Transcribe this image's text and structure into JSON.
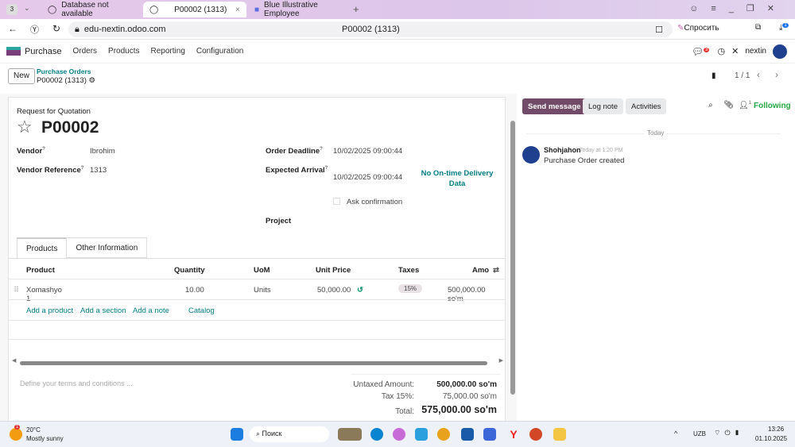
{
  "browser": {
    "tab_count": "3",
    "tabs": [
      {
        "label": "Database not available"
      },
      {
        "label": "P00002 (1313)"
      },
      {
        "label": "Blue Illustrative Employee"
      }
    ],
    "url": "edu-nextin.odoo.com",
    "page_title": "P00002 (1313)",
    "ask_label": "Спросить",
    "download_badge": "1"
  },
  "navbar": {
    "app": "Purchase",
    "menus": [
      "Orders",
      "Products",
      "Reporting",
      "Configuration"
    ],
    "chat_badge": "3",
    "company": "nextin"
  },
  "control": {
    "new_label": "New",
    "breadcrumb_parent": "Purchase Orders",
    "breadcrumb_current": "P00002 (1313)",
    "pager": "1 / 1"
  },
  "form": {
    "subtitle": "Request for Quotation",
    "name": "P00002",
    "vendor_label": "Vendor",
    "vendor": "Ibrohim",
    "vendor_ref_label": "Vendor Reference",
    "vendor_ref": "1313",
    "deadline_label": "Order Deadline",
    "deadline": "10/02/2025 09:00:44",
    "arrival_label": "Expected Arrival",
    "arrival": "10/02/2025 09:00:44",
    "otd": "No On-time Delivery Data",
    "ask_confirmation": "Ask confirmation",
    "project_label": "Project",
    "tabs": [
      "Products",
      "Other Information"
    ],
    "columns": [
      "Product",
      "Quantity",
      "UoM",
      "Unit Price",
      "Taxes",
      "Amo"
    ],
    "lines": [
      {
        "product": "Xomashyo 1",
        "quantity": "10.00",
        "uom": "Units",
        "unit_price": "50,000.00",
        "taxes": "15%",
        "amount": "500,000.00 so'm"
      }
    ],
    "actions": [
      "Add a product",
      "Add a section",
      "Add a note",
      "Catalog"
    ],
    "terms_placeholder": "Define your terms and conditions ...",
    "totals": {
      "untaxed_label": "Untaxed Amount:",
      "untaxed": "500,000.00 so'm",
      "tax_label": "Tax 15%:",
      "tax": "75,000.00 so'm",
      "total_label": "Total:",
      "total": "575,000.00 so'm"
    }
  },
  "chatter": {
    "send": "Send message",
    "log": "Log note",
    "activities": "Activities",
    "followers": "1",
    "following": "Following",
    "date_sep": "Today",
    "author": "Shohjahon",
    "time": "Today at 1:20 PM",
    "message": "Purchase Order created"
  },
  "taskbar": {
    "temp": "20°C",
    "weather": "Mostly sunny",
    "weather_badge": "1",
    "search": "Поиск",
    "lang": "UZB",
    "time": "13:26",
    "date": "01.10.2025"
  }
}
